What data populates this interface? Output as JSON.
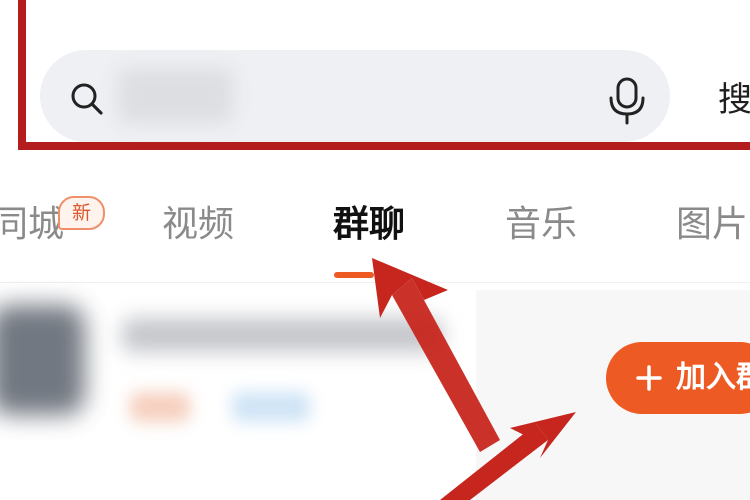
{
  "search": {
    "placeholder_hidden": true,
    "button_label": "搜",
    "icons": {
      "search": "search-icon",
      "voice": "microphone-icon"
    }
  },
  "tabs": [
    {
      "label": "同城",
      "badge": "新",
      "active": false
    },
    {
      "label": "视频",
      "active": false
    },
    {
      "label": "群聊",
      "active": true
    },
    {
      "label": "音乐",
      "active": false
    },
    {
      "label": "图片",
      "active": false
    }
  ],
  "group_card": {
    "join_button_label": "加入群",
    "join_icon": "plus-icon"
  },
  "colors": {
    "accent": "#ee5a24",
    "highlight_box": "#b41d1d",
    "search_bar_bg": "#eef0f3",
    "annotation_arrow": "#c6261d"
  }
}
